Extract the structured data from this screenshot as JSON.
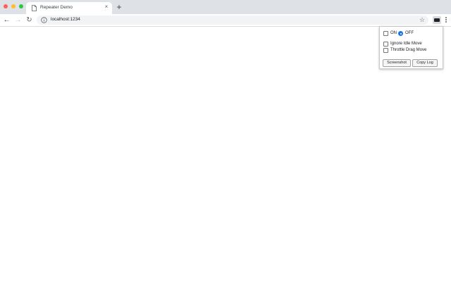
{
  "tab": {
    "title": "Repeater Demo",
    "close_icon": "close-icon"
  },
  "toolbar": {
    "url": "localhost:1234"
  },
  "popup": {
    "on_label": "ON",
    "off_label": "OFF",
    "mode_selected": "OFF",
    "ignore_idle_label": "Ignore Idle Move",
    "ignore_idle_checked": false,
    "throttle_drag_label": "Throttle Drag Move",
    "throttle_drag_checked": false,
    "screenshot_label": "Screenshot",
    "copy_log_label": "Copy Log"
  },
  "colors": {
    "accent": "#1a73e8",
    "tabstrip": "#dee1e6"
  }
}
